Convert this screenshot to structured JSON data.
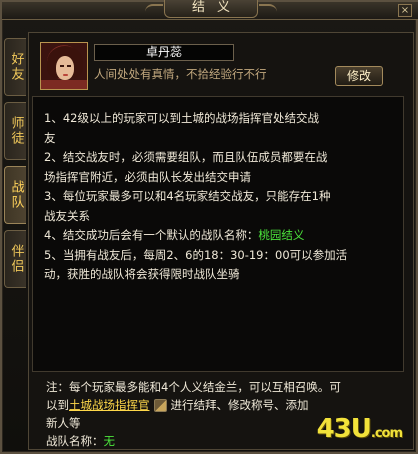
{
  "window": {
    "title": "结义",
    "close_label": "×"
  },
  "tabs": [
    {
      "label": "好友",
      "active": false
    },
    {
      "label": "师徒",
      "active": false
    },
    {
      "label": "战队",
      "active": true
    },
    {
      "label": "伴侣",
      "active": false
    }
  ],
  "profile": {
    "name": "卓丹蕊",
    "motto": "人间处处有真情，不拾经验行不行",
    "modify_label": "修改"
  },
  "rules": {
    "line1": "1、42级以上的玩家可以到土城的战场指挥官处结交战",
    "line2": "友",
    "line3": "2、结交战友时，必须需要组队，而且队伍成员都要在战",
    "line4": "场指挥官附近，必须由队长发出结交申请",
    "line5": "3、每位玩家最多可以和4名玩家结交战友，只能存在1种",
    "line6": "战友关系",
    "line7_prefix": "4、结交成功后会有一个默认的战队名称：",
    "line7_default_name": "桃园结义",
    "line8": "5、当拥有战友后，每周2、6的18：30-19：00可以参加活",
    "line9": "动，获胜的战队将会获得限时战队坐骑"
  },
  "note": {
    "line1": "注：每个玩家最多能和4个人义结金兰，可以互相召唤。可",
    "line2_prefix": "以到",
    "line2_link": "土城战场指挥官",
    "line2_suffix": "进行结拜、修改称号、添加",
    "line3": "新人等",
    "team_label": "战队名称：",
    "team_value": "无"
  },
  "watermark": {
    "main": "43U",
    "suffix": ".com"
  },
  "colors": {
    "accent_gold": "#ffd84a",
    "green_text": "#4ce63c",
    "tab_text": "#f0c85a",
    "motto_text": "#c3a97f",
    "watermark": "#f2e23a"
  }
}
